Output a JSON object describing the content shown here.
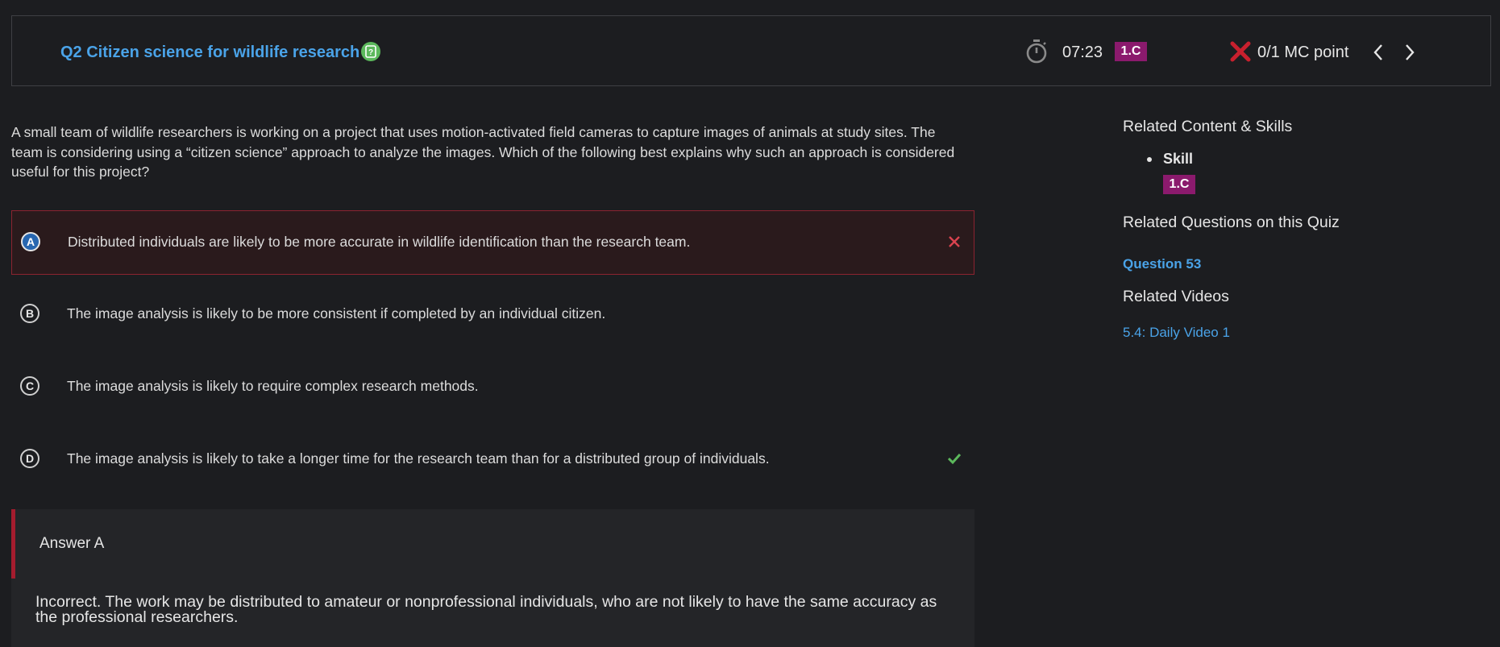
{
  "header": {
    "question_title": "Q2 Citizen science for wildlife research",
    "help_icon": "question-mark-icon",
    "timer": "07:23",
    "skill_badge": "1.C",
    "score": "0/1 MC point",
    "colors": {
      "accent": "#4aa3e8",
      "badge": "#8b1a6d",
      "incorrect": "#c8202e",
      "correct": "#5cb85c"
    }
  },
  "question": {
    "text": "A small team of wildlife researchers is working on a project that uses motion-activated field cameras to capture images of animals at study sites. The team is considering using a “citizen science” approach to analyze the images. Which of the following best explains why such an approach is considered useful for this project?"
  },
  "options": [
    {
      "letter": "A",
      "text": "Distributed individuals are likely to be more accurate in wildlife identification than the research team.",
      "state": "selected-incorrect"
    },
    {
      "letter": "B",
      "text": "The image analysis is likely to be more consistent if completed by an individual citizen.",
      "state": "none"
    },
    {
      "letter": "C",
      "text": "The image analysis is likely to require complex research methods.",
      "state": "none"
    },
    {
      "letter": "D",
      "text": "The image analysis is likely to take a longer time for the research team than for a distributed group of individuals.",
      "state": "correct"
    }
  ],
  "explanation": {
    "title": "Answer A",
    "text": "Incorrect. The work may be distributed to amateur or nonprofessional individuals, who are not likely to have the same accuracy as the professional researchers."
  },
  "sidebar": {
    "related_content_heading": "Related Content & Skills",
    "skill_label": "Skill",
    "skill_badge": "1.C",
    "related_questions_heading": "Related Questions on this Quiz",
    "related_question_link": "Question 53",
    "related_videos_heading": "Related Videos",
    "related_video_link": "5.4: Daily Video 1"
  }
}
